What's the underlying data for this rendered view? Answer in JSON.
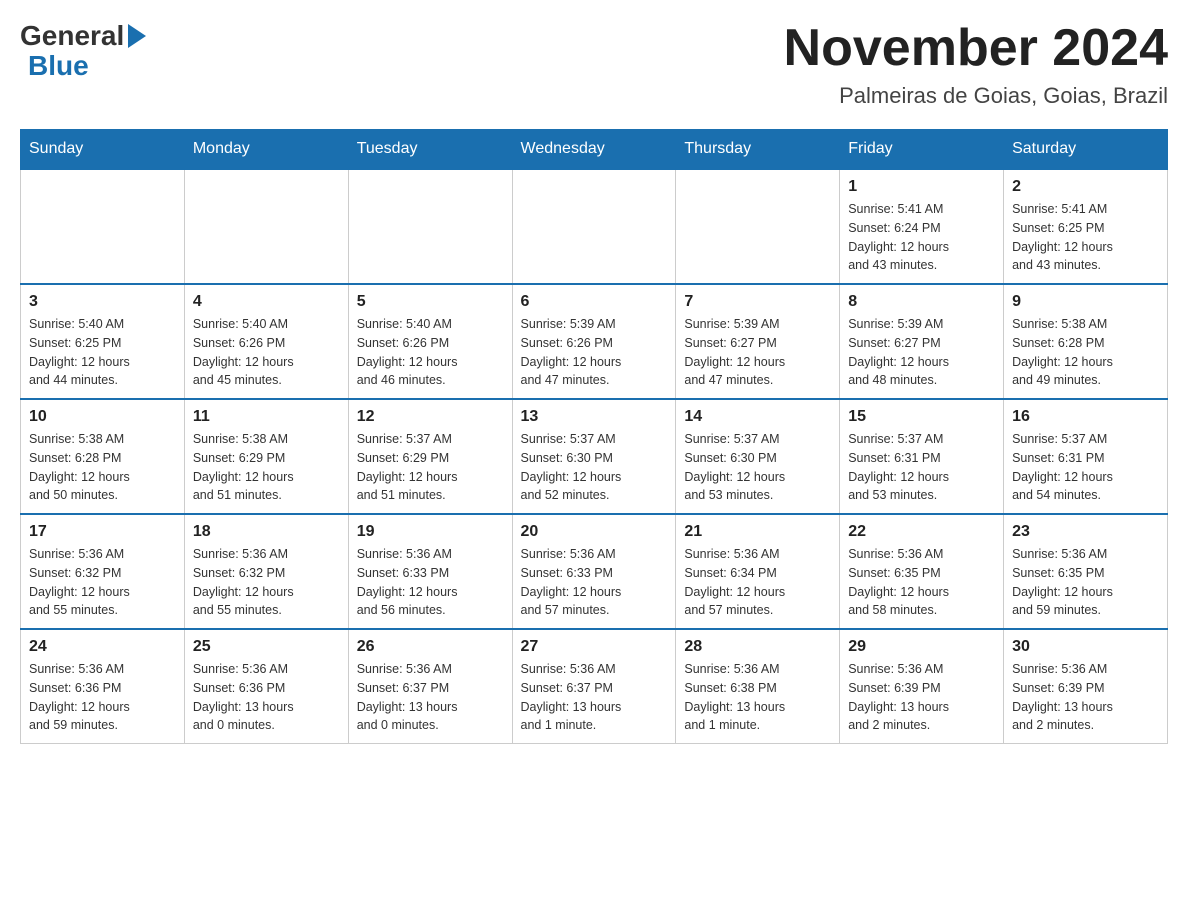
{
  "header": {
    "logo_general": "General",
    "logo_blue": "Blue",
    "month_title": "November 2024",
    "location": "Palmeiras de Goias, Goias, Brazil"
  },
  "weekdays": [
    "Sunday",
    "Monday",
    "Tuesday",
    "Wednesday",
    "Thursday",
    "Friday",
    "Saturday"
  ],
  "weeks": [
    {
      "days": [
        {
          "num": "",
          "info": ""
        },
        {
          "num": "",
          "info": ""
        },
        {
          "num": "",
          "info": ""
        },
        {
          "num": "",
          "info": ""
        },
        {
          "num": "",
          "info": ""
        },
        {
          "num": "1",
          "info": "Sunrise: 5:41 AM\nSunset: 6:24 PM\nDaylight: 12 hours\nand 43 minutes."
        },
        {
          "num": "2",
          "info": "Sunrise: 5:41 AM\nSunset: 6:25 PM\nDaylight: 12 hours\nand 43 minutes."
        }
      ]
    },
    {
      "days": [
        {
          "num": "3",
          "info": "Sunrise: 5:40 AM\nSunset: 6:25 PM\nDaylight: 12 hours\nand 44 minutes."
        },
        {
          "num": "4",
          "info": "Sunrise: 5:40 AM\nSunset: 6:26 PM\nDaylight: 12 hours\nand 45 minutes."
        },
        {
          "num": "5",
          "info": "Sunrise: 5:40 AM\nSunset: 6:26 PM\nDaylight: 12 hours\nand 46 minutes."
        },
        {
          "num": "6",
          "info": "Sunrise: 5:39 AM\nSunset: 6:26 PM\nDaylight: 12 hours\nand 47 minutes."
        },
        {
          "num": "7",
          "info": "Sunrise: 5:39 AM\nSunset: 6:27 PM\nDaylight: 12 hours\nand 47 minutes."
        },
        {
          "num": "8",
          "info": "Sunrise: 5:39 AM\nSunset: 6:27 PM\nDaylight: 12 hours\nand 48 minutes."
        },
        {
          "num": "9",
          "info": "Sunrise: 5:38 AM\nSunset: 6:28 PM\nDaylight: 12 hours\nand 49 minutes."
        }
      ]
    },
    {
      "days": [
        {
          "num": "10",
          "info": "Sunrise: 5:38 AM\nSunset: 6:28 PM\nDaylight: 12 hours\nand 50 minutes."
        },
        {
          "num": "11",
          "info": "Sunrise: 5:38 AM\nSunset: 6:29 PM\nDaylight: 12 hours\nand 51 minutes."
        },
        {
          "num": "12",
          "info": "Sunrise: 5:37 AM\nSunset: 6:29 PM\nDaylight: 12 hours\nand 51 minutes."
        },
        {
          "num": "13",
          "info": "Sunrise: 5:37 AM\nSunset: 6:30 PM\nDaylight: 12 hours\nand 52 minutes."
        },
        {
          "num": "14",
          "info": "Sunrise: 5:37 AM\nSunset: 6:30 PM\nDaylight: 12 hours\nand 53 minutes."
        },
        {
          "num": "15",
          "info": "Sunrise: 5:37 AM\nSunset: 6:31 PM\nDaylight: 12 hours\nand 53 minutes."
        },
        {
          "num": "16",
          "info": "Sunrise: 5:37 AM\nSunset: 6:31 PM\nDaylight: 12 hours\nand 54 minutes."
        }
      ]
    },
    {
      "days": [
        {
          "num": "17",
          "info": "Sunrise: 5:36 AM\nSunset: 6:32 PM\nDaylight: 12 hours\nand 55 minutes."
        },
        {
          "num": "18",
          "info": "Sunrise: 5:36 AM\nSunset: 6:32 PM\nDaylight: 12 hours\nand 55 minutes."
        },
        {
          "num": "19",
          "info": "Sunrise: 5:36 AM\nSunset: 6:33 PM\nDaylight: 12 hours\nand 56 minutes."
        },
        {
          "num": "20",
          "info": "Sunrise: 5:36 AM\nSunset: 6:33 PM\nDaylight: 12 hours\nand 57 minutes."
        },
        {
          "num": "21",
          "info": "Sunrise: 5:36 AM\nSunset: 6:34 PM\nDaylight: 12 hours\nand 57 minutes."
        },
        {
          "num": "22",
          "info": "Sunrise: 5:36 AM\nSunset: 6:35 PM\nDaylight: 12 hours\nand 58 minutes."
        },
        {
          "num": "23",
          "info": "Sunrise: 5:36 AM\nSunset: 6:35 PM\nDaylight: 12 hours\nand 59 minutes."
        }
      ]
    },
    {
      "days": [
        {
          "num": "24",
          "info": "Sunrise: 5:36 AM\nSunset: 6:36 PM\nDaylight: 12 hours\nand 59 minutes."
        },
        {
          "num": "25",
          "info": "Sunrise: 5:36 AM\nSunset: 6:36 PM\nDaylight: 13 hours\nand 0 minutes."
        },
        {
          "num": "26",
          "info": "Sunrise: 5:36 AM\nSunset: 6:37 PM\nDaylight: 13 hours\nand 0 minutes."
        },
        {
          "num": "27",
          "info": "Sunrise: 5:36 AM\nSunset: 6:37 PM\nDaylight: 13 hours\nand 1 minute."
        },
        {
          "num": "28",
          "info": "Sunrise: 5:36 AM\nSunset: 6:38 PM\nDaylight: 13 hours\nand 1 minute."
        },
        {
          "num": "29",
          "info": "Sunrise: 5:36 AM\nSunset: 6:39 PM\nDaylight: 13 hours\nand 2 minutes."
        },
        {
          "num": "30",
          "info": "Sunrise: 5:36 AM\nSunset: 6:39 PM\nDaylight: 13 hours\nand 2 minutes."
        }
      ]
    }
  ]
}
